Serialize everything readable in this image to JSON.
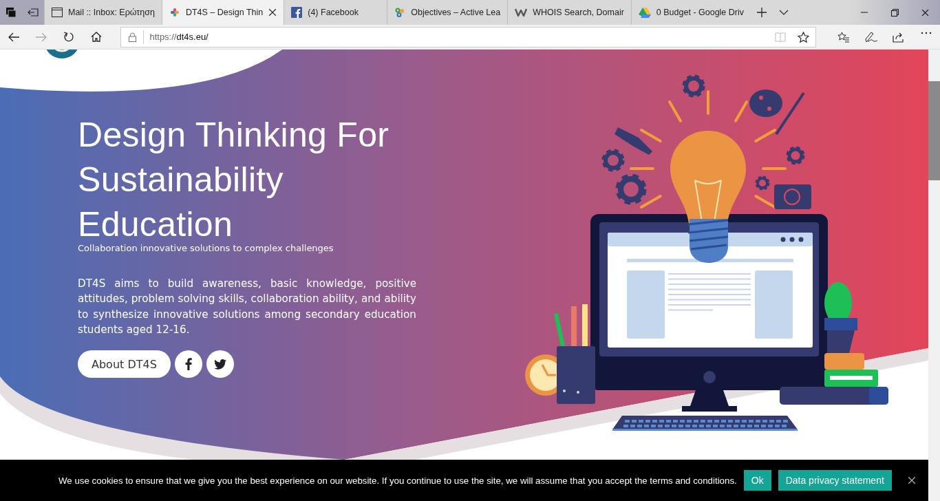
{
  "browser": {
    "tabs": [
      {
        "title": "Mail :: Inbox: Ερώτηση",
        "selected": false
      },
      {
        "title": "DT4S – Design Thin",
        "selected": true
      },
      {
        "title": "(4) Facebook",
        "selected": false
      },
      {
        "title": "Objectives – Active Lea",
        "selected": false
      },
      {
        "title": "WHOIS Search, Domair",
        "selected": false
      },
      {
        "title": "0 Budget - Google Driv",
        "selected": false
      }
    ],
    "url": {
      "scheme": "https://",
      "host": "dt4s.eu/"
    }
  },
  "hero": {
    "title": "Design Thinking For Sustainability Education",
    "subtitle": "Collaboration innovative solutions to complex challenges",
    "description": "DT4S aims to build awareness, basic knowledge, positive attitudes, problem solving skills, collaboration ability, and ability to synthesize innovative solutions among secondary education students aged 12-16.",
    "button": "About DT4S"
  },
  "cookie_bar": {
    "text": "We use cookies to ensure that we give you the best experience on our website. If you continue to use the site, we will assume that you accept the terms and conditions.",
    "buttons": [
      "Ok",
      "Data privacy statement"
    ]
  }
}
